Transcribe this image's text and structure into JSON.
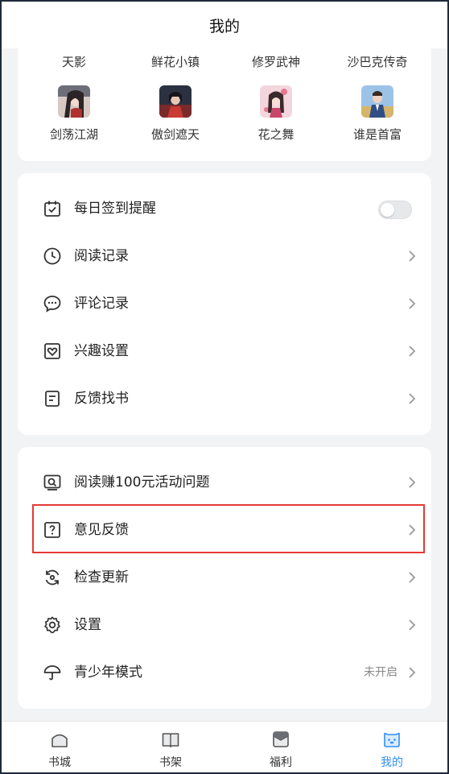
{
  "header": {
    "title": "我的"
  },
  "books": {
    "row1": [
      "天影",
      "鲜花小镇",
      "修罗武神",
      "沙巴克传奇"
    ],
    "row2": [
      "剑荡江湖",
      "傲剑遮天",
      "花之舞",
      "谁是首富"
    ]
  },
  "menu1": {
    "items": [
      {
        "label": "每日签到提醒",
        "icon": "calendar-check-icon"
      },
      {
        "label": "阅读记录",
        "icon": "clock-icon"
      },
      {
        "label": "评论记录",
        "icon": "chat-bubble-icon"
      },
      {
        "label": "兴趣设置",
        "icon": "heart-square-icon"
      },
      {
        "label": "反馈找书",
        "icon": "document-icon"
      }
    ]
  },
  "menu2": {
    "items": [
      {
        "label": "阅读赚100元活动问题",
        "icon": "search-screen-icon"
      },
      {
        "label": "意见反馈",
        "icon": "question-icon"
      },
      {
        "label": "检查更新",
        "icon": "refresh-icon"
      },
      {
        "label": "设置",
        "icon": "gear-icon"
      },
      {
        "label": "青少年模式",
        "icon": "umbrella-icon",
        "status": "未开启"
      }
    ]
  },
  "tabs": [
    {
      "label": "书城",
      "icon": "home-icon"
    },
    {
      "label": "书架",
      "icon": "book-icon"
    },
    {
      "label": "福利",
      "icon": "gift-icon"
    },
    {
      "label": "我的",
      "icon": "profile-icon",
      "active": true
    }
  ],
  "colors": {
    "accent": "#2f8ff5",
    "highlight": "#e53935"
  }
}
